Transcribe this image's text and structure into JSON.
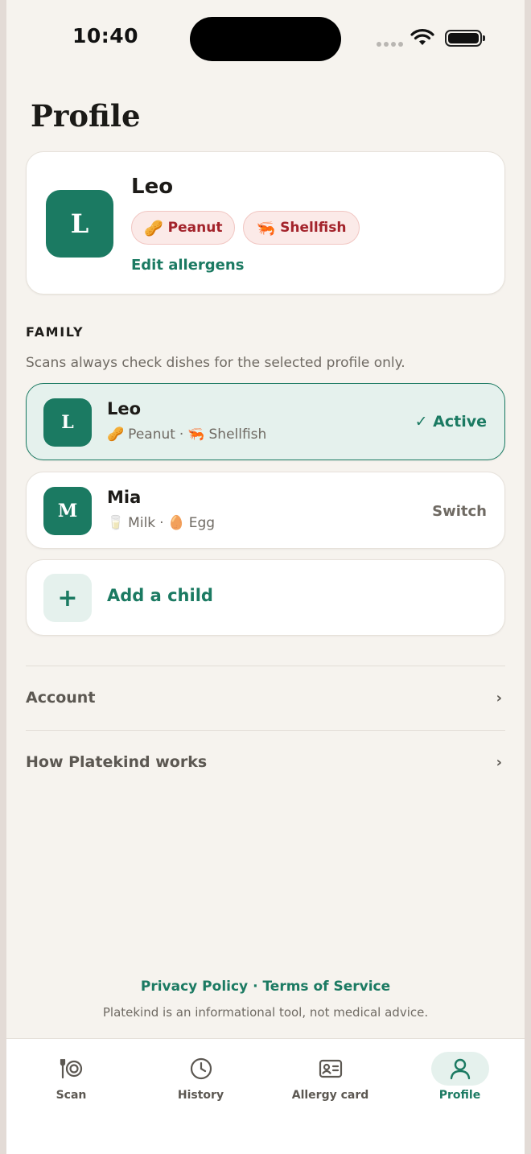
{
  "status_bar": {
    "time": "10:40"
  },
  "page": {
    "title": "Profile"
  },
  "profile_card": {
    "initial": "L",
    "name": "Leo",
    "allergens": [
      {
        "emoji": "🥜",
        "label": "Peanut"
      },
      {
        "emoji": "🦐",
        "label": "Shellfish"
      }
    ],
    "edit_label": "Edit allergens"
  },
  "family": {
    "label": "FAMILY",
    "note": "Scans always check dishes for the selected profile only.",
    "members": [
      {
        "initial": "L",
        "name": "Leo",
        "a1_emoji": "🥜",
        "a1": "Peanut",
        "sep": "·",
        "a2_emoji": "🦐",
        "a2": "Shellfish",
        "status": "✓ Active"
      },
      {
        "initial": "M",
        "name": "Mia",
        "a1_emoji": "🥛",
        "a1": "Milk",
        "sep": "·",
        "a2_emoji": "🥚",
        "a2": "Egg",
        "status": "Switch"
      }
    ],
    "add_icon": "+",
    "add_label": "Add a child"
  },
  "settings": [
    {
      "label": "Account",
      "chevron": "›"
    },
    {
      "label": "How Platekind works",
      "chevron": "›"
    }
  ],
  "footer": {
    "privacy": "Privacy Policy",
    "dot": "·",
    "terms": "Terms of Service",
    "disclaimer": "Platekind is an informational tool, not medical advice."
  },
  "tabs": [
    {
      "label": "Scan",
      "icon": "plate-utensils-icon"
    },
    {
      "label": "History",
      "icon": "clock-icon"
    },
    {
      "label": "Allergy card",
      "icon": "id-card-icon"
    },
    {
      "label": "Profile",
      "icon": "person-icon"
    }
  ],
  "colors": {
    "accent": "#1b7a62",
    "accent_soft": "#e5f1ed",
    "chip_bg": "#fbeae8",
    "chip_text": "#a3232b",
    "background": "#f6f3ee"
  }
}
